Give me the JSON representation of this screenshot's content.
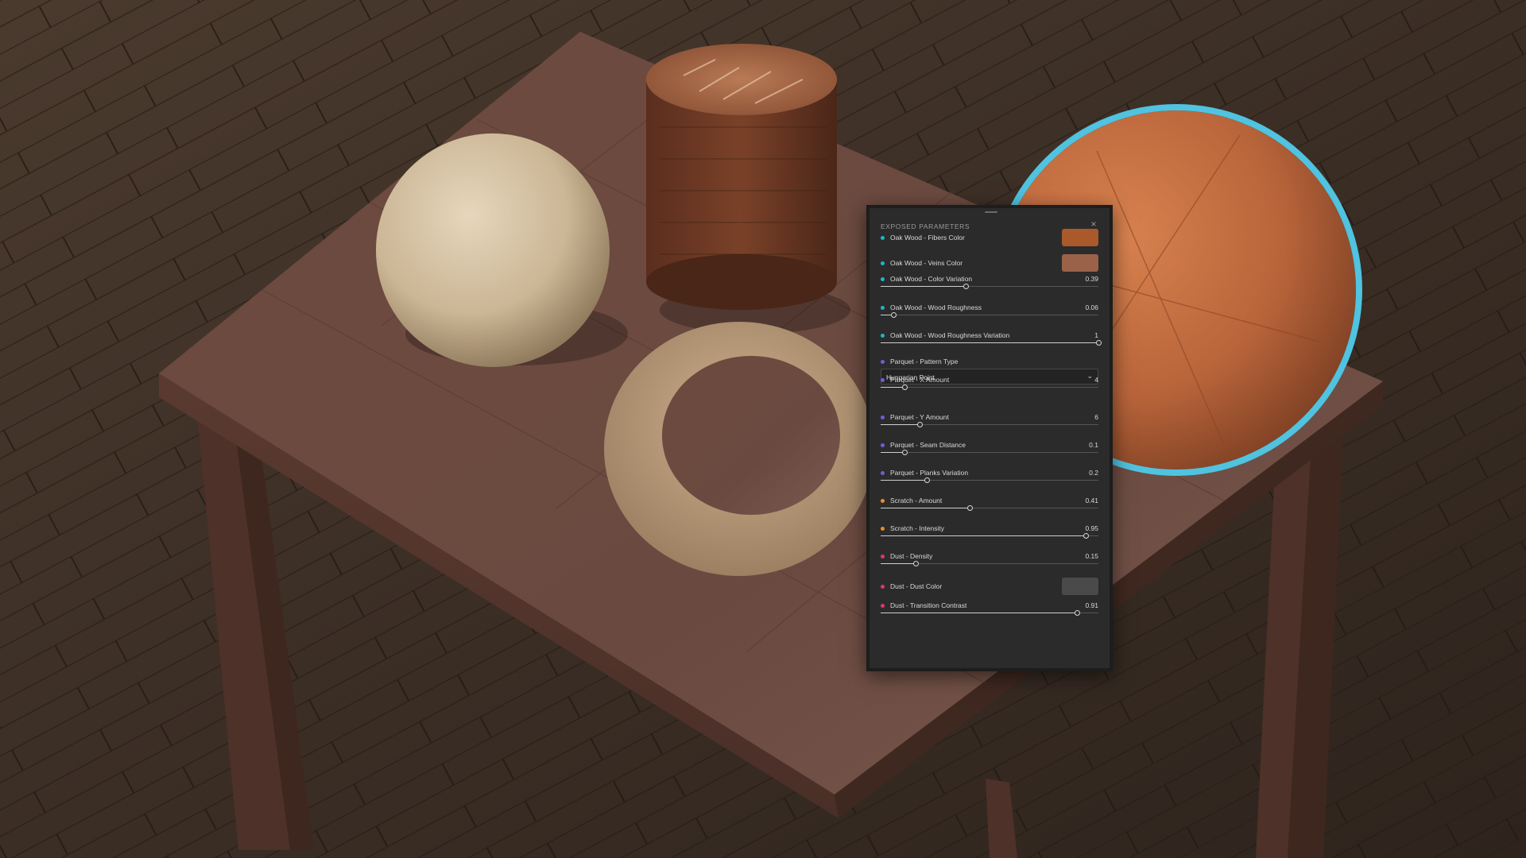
{
  "panel": {
    "title": "EXPOSED PARAMETERS",
    "close_glyph": "×",
    "params": [
      {
        "type": "color",
        "group": "oak",
        "label": "Oak Wood - Fibers Color",
        "swatch": "#a9592a"
      },
      {
        "type": "color",
        "group": "oak",
        "label": "Oak Wood - Veins Color",
        "swatch": "#9a6248"
      },
      {
        "type": "slider",
        "group": "oak",
        "label": "Oak Wood - Color Variation",
        "value": "0.39",
        "fraction": 0.39
      },
      {
        "type": "slider",
        "group": "oak",
        "label": "Oak Wood - Wood Roughness",
        "value": "0.06",
        "fraction": 0.06
      },
      {
        "type": "slider",
        "group": "oak",
        "label": "Oak Wood - Wood Roughness Variation",
        "value": "1",
        "fraction": 1.0
      },
      {
        "type": "dropdown",
        "group": "parquet",
        "label": "Parquet - Pattern Type",
        "selected": "Hungarian Point"
      },
      {
        "type": "slider",
        "group": "parquet",
        "label": "Parquet - X Amount",
        "value": "4",
        "fraction": 0.11
      },
      {
        "type": "slider",
        "group": "parquet",
        "label": "Parquet - Y Amount",
        "value": "6",
        "fraction": 0.18
      },
      {
        "type": "slider",
        "group": "parquet",
        "label": "Parquet - Seam Distance",
        "value": "0.1",
        "fraction": 0.11
      },
      {
        "type": "slider",
        "group": "parquet",
        "label": "Parquet - Planks Variation",
        "value": "0.2",
        "fraction": 0.21
      },
      {
        "type": "slider",
        "group": "scratch",
        "label": "Scratch - Amount",
        "value": "0.41",
        "fraction": 0.41
      },
      {
        "type": "slider",
        "group": "scratch",
        "label": "Scratch - Intensity",
        "value": "0.95",
        "fraction": 0.94
      },
      {
        "type": "slider",
        "group": "dust",
        "label": "Dust - Density",
        "value": "0.15",
        "fraction": 0.16
      },
      {
        "type": "color",
        "group": "dust",
        "label": "Dust - Dust Color",
        "swatch": "#4a4a4a"
      },
      {
        "type": "slider",
        "group": "dust",
        "label": "Dust - Transition Contrast",
        "value": "0.91",
        "fraction": 0.9
      }
    ]
  },
  "colors": {
    "oak": "#1fb5c5",
    "parquet": "#6b5fe0",
    "scratch": "#f08a22",
    "dust": "#e0366e",
    "highlight_ring": "#4fc3e0"
  }
}
